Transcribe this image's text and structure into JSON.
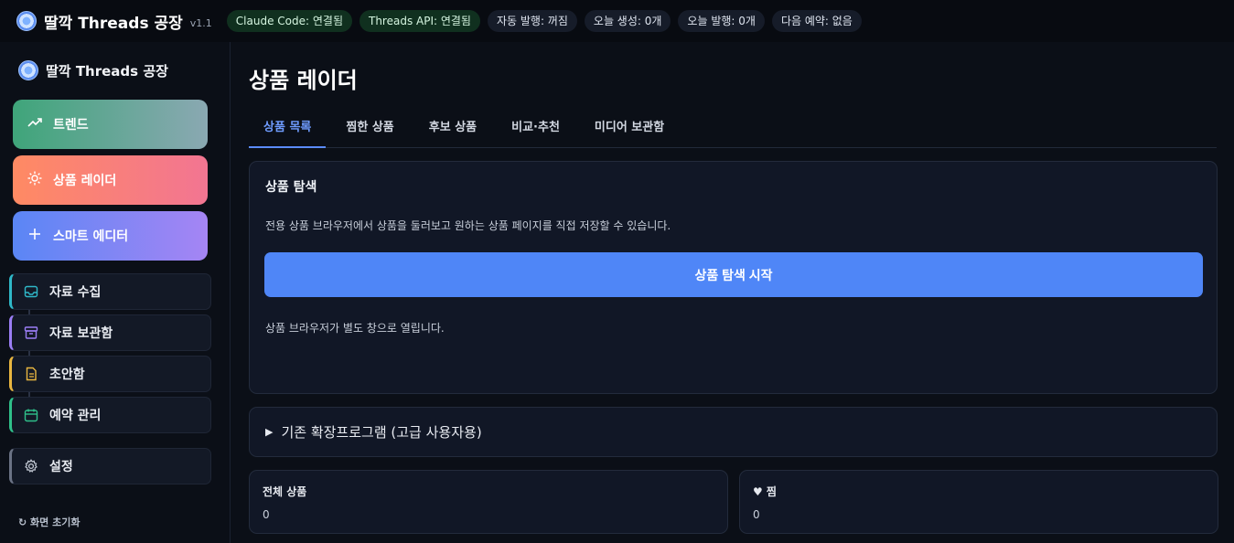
{
  "app": {
    "title": "딸깍 Threads 공장",
    "version": "v1.1"
  },
  "status_badges": [
    {
      "label": "Claude Code: 연결됨",
      "state": "ok"
    },
    {
      "label": "Threads API: 연결됨",
      "state": "ok"
    },
    {
      "label": "자동 발행: 꺼짐",
      "state": "neutral"
    },
    {
      "label": "오늘 생성: 0개",
      "state": "neutral"
    },
    {
      "label": "오늘 발행: 0개",
      "state": "neutral"
    },
    {
      "label": "다음 예약: 없음",
      "state": "neutral"
    }
  ],
  "sidebar": {
    "brand": "딸깍 Threads 공장",
    "primary": [
      {
        "label": "트렌드",
        "icon": "trending-up-icon"
      },
      {
        "label": "상품 레이더",
        "icon": "sun-icon"
      },
      {
        "label": "스마트 에디터",
        "icon": "plus-icon"
      }
    ],
    "items": [
      {
        "label": "자료 수집",
        "icon": "inbox-icon",
        "accent": "#2fb8c8"
      },
      {
        "label": "자료 보관함",
        "icon": "archive-icon",
        "accent": "#9b7ef5"
      },
      {
        "label": "초안함",
        "icon": "file-icon",
        "accent": "#e9b640"
      },
      {
        "label": "예약 관리",
        "icon": "calendar-icon",
        "accent": "#2fc08a"
      },
      {
        "label": "설정",
        "icon": "gear-icon",
        "accent": "#6b7385"
      }
    ],
    "reset": "↻ 화면 초기화"
  },
  "main": {
    "title": "상품 레이더",
    "tabs": [
      {
        "label": "상품 목록",
        "active": true
      },
      {
        "label": "찜한 상품",
        "active": false
      },
      {
        "label": "후보 상품",
        "active": false
      },
      {
        "label": "비교·추천",
        "active": false
      },
      {
        "label": "미디어 보관함",
        "active": false
      }
    ],
    "search_card": {
      "title": "상품 탐색",
      "description": "전용 상품 브라우저에서 상품을 둘러보고 원하는 상품 페이지를 직접 저장할 수 있습니다.",
      "button": "상품 탐색 시작",
      "note": "상품 브라우저가 별도 창으로 열립니다."
    },
    "legacy": {
      "toggle": "▶",
      "label": "기존 확장프로그램 (고급 사용자용)"
    },
    "stats": [
      {
        "label": "전체 상품",
        "value": "0"
      },
      {
        "label": "♥ 찜",
        "value": "0"
      }
    ]
  },
  "colors": {
    "accent": "#4f86f7",
    "tab_active": "#6f9cff",
    "ok_badge": "#10301f"
  }
}
